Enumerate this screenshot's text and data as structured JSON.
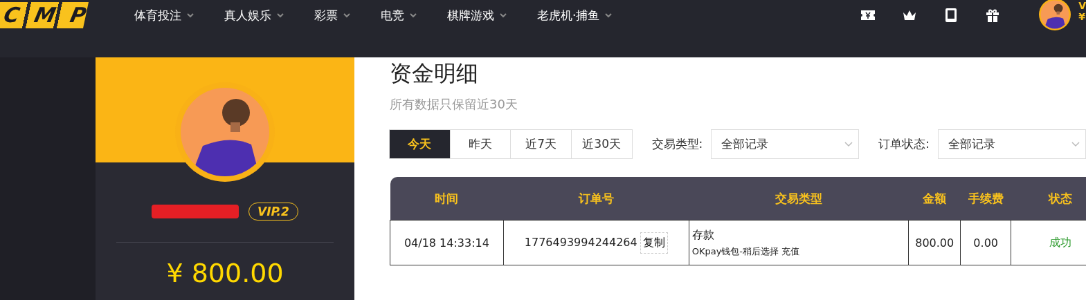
{
  "header": {
    "logo": "CMP",
    "nav": [
      {
        "label": "体育投注"
      },
      {
        "label": "真人娱乐"
      },
      {
        "label": "彩票"
      },
      {
        "label": "电竞"
      },
      {
        "label": "棋牌游戏"
      },
      {
        "label": "老虎机·捕鱼"
      }
    ],
    "user_initial": "V",
    "user_currency": "¥"
  },
  "profile": {
    "vip": "VIP.2",
    "balance": "¥ 800.00"
  },
  "page": {
    "title": "资金明细",
    "subtitle": "所有数据只保留近30天"
  },
  "periods": [
    {
      "label": "今天",
      "selected": true
    },
    {
      "label": "昨天",
      "selected": false
    },
    {
      "label": "近7天",
      "selected": false
    },
    {
      "label": "近30天",
      "selected": false
    }
  ],
  "filters": [
    {
      "label": "交易类型:",
      "value": "全部记录"
    },
    {
      "label": "订单状态:",
      "value": "全部记录"
    }
  ],
  "table": {
    "columns": [
      "时间",
      "订单号",
      "交易类型",
      "金额",
      "手续费",
      "状态"
    ],
    "rows": [
      {
        "time": "04/18 14:33:14",
        "order_no": "1776493994244264",
        "copy": "复制",
        "type": "存款",
        "type_detail": "OKpay钱包-稍后选择 充值",
        "amount": "800.00",
        "fee": "0.00",
        "status": "成功"
      }
    ]
  }
}
